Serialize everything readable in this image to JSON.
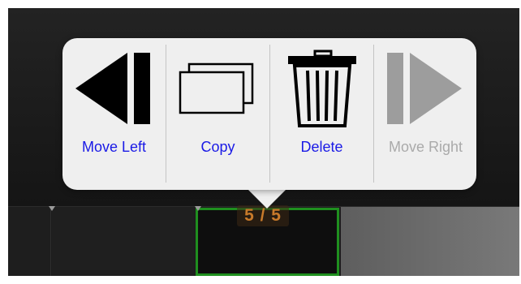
{
  "popover": {
    "items": [
      {
        "label": "Move Left",
        "icon": "move-left-icon",
        "enabled": true
      },
      {
        "label": "Copy",
        "icon": "copy-icon",
        "enabled": true
      },
      {
        "label": "Delete",
        "icon": "trash-icon",
        "enabled": true
      },
      {
        "label": "Move Right",
        "icon": "move-right-icon",
        "enabled": false
      }
    ]
  },
  "strip": {
    "counter": "5 / 5"
  },
  "colors": {
    "label_active": "#1a1ae6",
    "label_disabled": "#aaaaaa",
    "selection_border": "#1f8f1f",
    "counter_text": "#c87a2a"
  }
}
